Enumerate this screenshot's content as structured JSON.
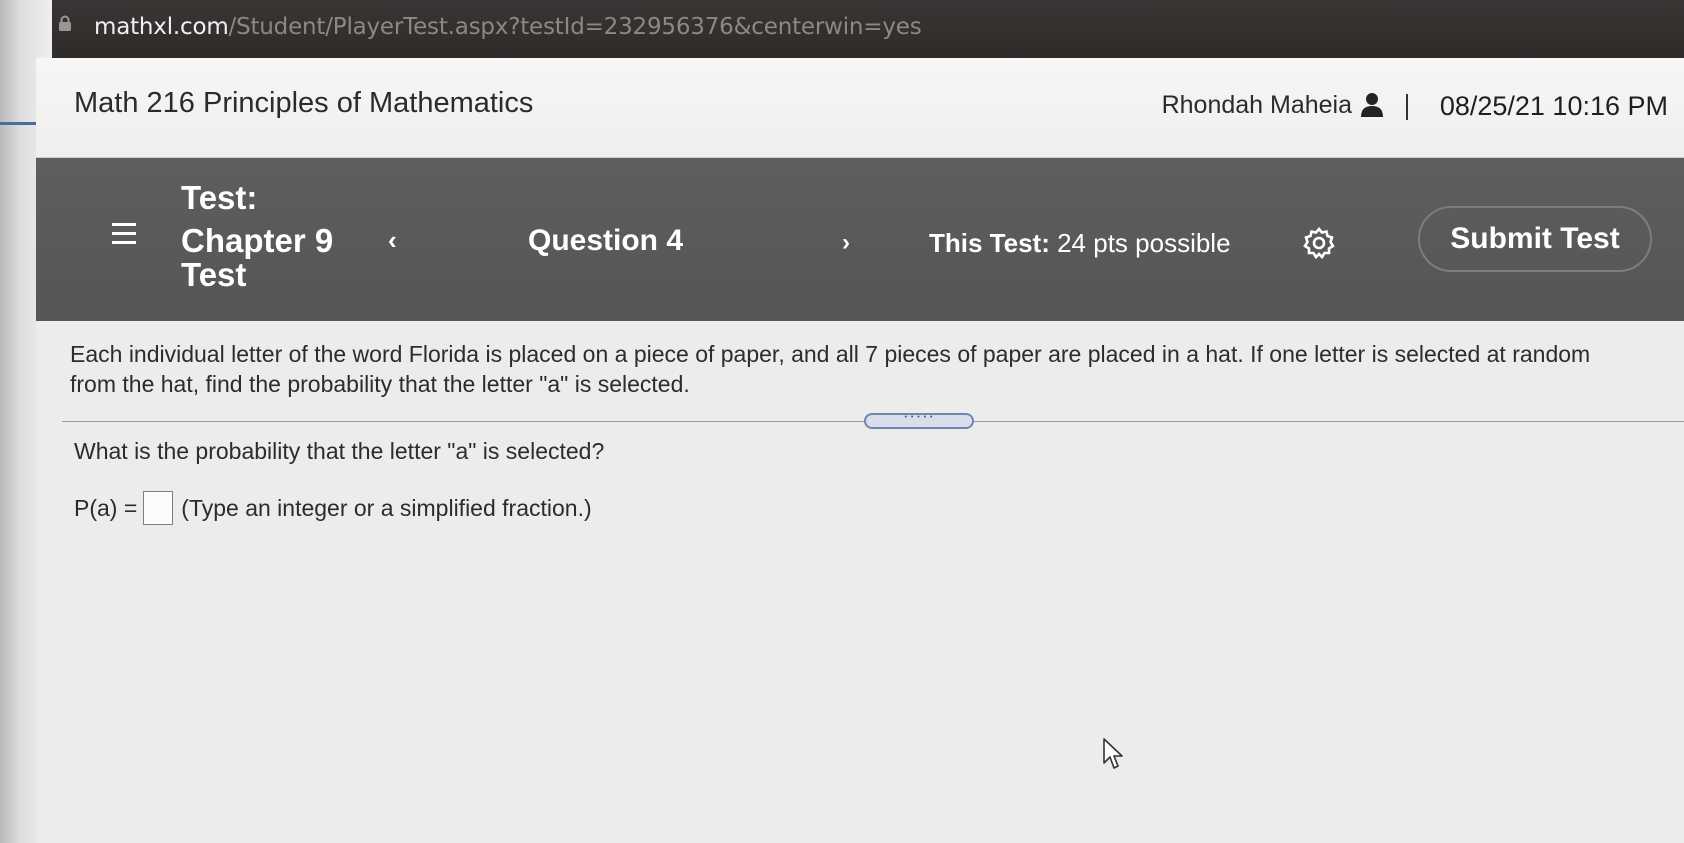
{
  "browser": {
    "url_host": "mathxl.com",
    "url_path": "/Student/PlayerTest.aspx?testId=232956376&centerwin=yes"
  },
  "header": {
    "course_title": "Math 216 Principles of Mathematics",
    "user_name": "Rhondah Maheia",
    "datetime": "08/25/21 10:16 PM"
  },
  "nav": {
    "test_label": "Test:",
    "test_name": "Chapter 9 Test",
    "prev_label": "‹",
    "question_label": "Question 4",
    "next_label": "›",
    "points_label": "This Test:",
    "points_value": "24 pts possible",
    "submit_label": "Submit Test"
  },
  "question": {
    "text": "Each individual letter of the word Florida is placed on a piece of paper, and all 7 pieces of paper are placed in a hat. If one letter is selected at random from the hat, find the probability that the letter \"a\" is selected.",
    "prompt": "What is the probability that the letter \"a\" is selected?",
    "answer_label": "P(a) =",
    "answer_value": "",
    "answer_hint": "(Type an integer or a simplified fraction.)"
  },
  "icons": {
    "lock": "lock-icon",
    "user": "user-icon",
    "menu": "hamburger-menu-icon",
    "settings": "gear-icon",
    "cursor": "mouse-pointer-icon"
  },
  "colors": {
    "nav_background": "#5a5a5a",
    "page_background": "#ececea",
    "divider_handle": "#6d86b3"
  }
}
